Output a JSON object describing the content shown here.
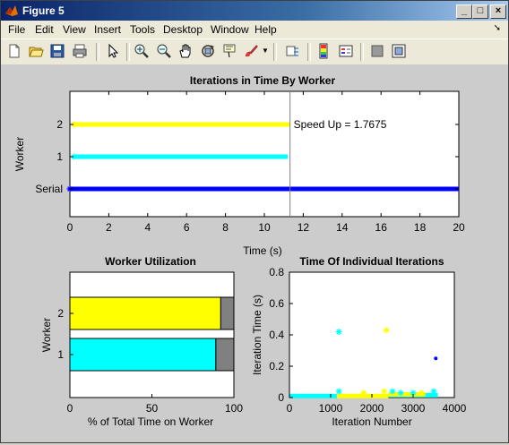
{
  "window": {
    "title": "Figure 5"
  },
  "menu": [
    "File",
    "Edit",
    "View",
    "Insert",
    "Tools",
    "Desktop",
    "Window",
    "Help"
  ],
  "toolbar": [
    "new-figure",
    "open-file",
    "save",
    "print",
    "edit-plot",
    "zoom-in",
    "zoom-out",
    "pan",
    "rotate-3d",
    "data-cursor",
    "brush",
    "link",
    "colorbar",
    "legend",
    "hide-plot-tools",
    "show-plot-tools"
  ],
  "chart_data": [
    {
      "type": "scatter",
      "title": "Iterations in Time By Worker",
      "xlabel": "Time (s)",
      "ylabel": "Worker",
      "xlim": [
        0,
        20
      ],
      "xticks": [
        "0",
        "2",
        "4",
        "6",
        "8",
        "10",
        "12",
        "14",
        "16",
        "18",
        "20"
      ],
      "yticks": [
        "Serial",
        "1",
        "2"
      ],
      "series": [
        {
          "name": "Serial",
          "color": "#0000ff",
          "y": 0,
          "x_range": [
            0,
            20
          ]
        },
        {
          "name": "1",
          "color": "#00ffff",
          "y": 1,
          "x_range": [
            0.2,
            11.2
          ]
        },
        {
          "name": "2",
          "color": "#ffff00",
          "y": 2,
          "x_range": [
            0.2,
            11.3
          ]
        }
      ],
      "vline_x": 11.32,
      "annotation": "Speed Up = 1.7675"
    },
    {
      "type": "bar",
      "orientation": "horizontal",
      "stacked": true,
      "title": "Worker Utilization",
      "xlabel": "% of Total Time on Worker",
      "ylabel": "Worker",
      "xlim": [
        0,
        100
      ],
      "xticks": [
        "0",
        "50",
        "100"
      ],
      "categories": [
        "1",
        "2"
      ],
      "series": [
        {
          "color": "#00ffff",
          "color2": "#ffff00",
          "values": [
            89,
            92
          ]
        },
        {
          "color": "#808080",
          "values": [
            11,
            8
          ]
        }
      ]
    },
    {
      "type": "scatter",
      "title": "Time Of Individual Iterations",
      "xlabel": "Iteration Number",
      "ylabel": "Iteration Time (s)",
      "xlim": [
        0,
        4000
      ],
      "ylim": [
        0,
        0.8
      ],
      "xticks": [
        "0",
        "1000",
        "2000",
        "3000",
        "4000"
      ],
      "yticks": [
        "0",
        "0.2",
        "0.4",
        "0.6",
        "0.8"
      ],
      "series": [
        {
          "name": "1",
          "color": "#00ffff",
          "points": [
            [
              1200,
              0.42
            ],
            [
              1200,
              0.04
            ],
            [
              2500,
              0.04
            ],
            [
              2700,
              0.03
            ],
            [
              3000,
              0.03
            ],
            [
              3500,
              0.04
            ]
          ]
        },
        {
          "name": "2",
          "color": "#ffff00",
          "points": [
            [
              2350,
              0.43
            ],
            [
              1800,
              0.03
            ],
            [
              2300,
              0.04
            ],
            [
              3200,
              0.03
            ]
          ]
        },
        {
          "name": "Serial",
          "color": "#0000ff",
          "points": [
            [
              3550,
              0.25
            ]
          ]
        }
      ],
      "bands": [
        {
          "color": "#00ffff",
          "x_range": [
            0,
            1150
          ],
          "y": 0.01
        },
        {
          "color": "#ffff00",
          "x_range": [
            1150,
            2400
          ],
          "y": 0.01
        },
        {
          "color": "#00ffff",
          "x_range": [
            2400,
            3600
          ],
          "y": 0.015
        },
        {
          "color": "#ffff00",
          "x_range": [
            2400,
            3300
          ],
          "y": 0.02
        }
      ]
    }
  ]
}
